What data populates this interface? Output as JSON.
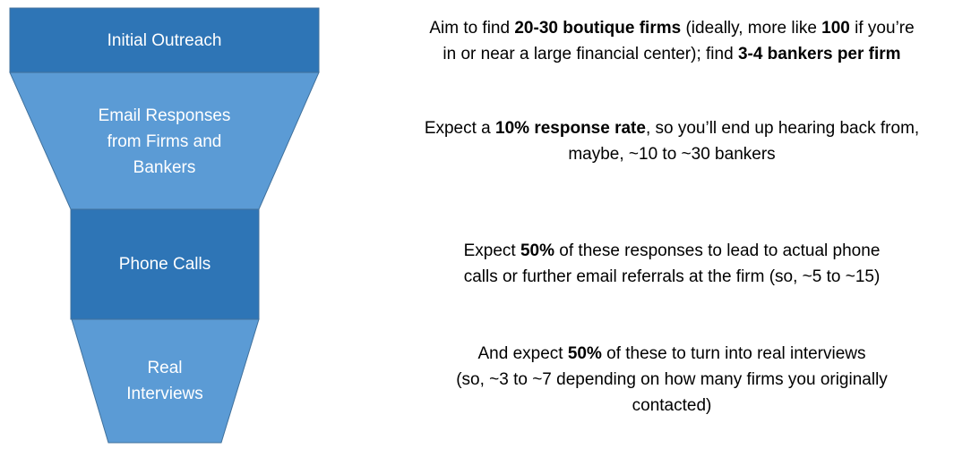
{
  "colors": {
    "dark_stage": "#2E75B6",
    "light_stage": "#5B9BD5",
    "outline": "#41719C"
  },
  "stages": [
    {
      "label": "Initial Outreach"
    },
    {
      "label": "Email Responses from Firms and Bankers"
    },
    {
      "label": "Phone Calls"
    },
    {
      "label": "Real Interviews"
    }
  ],
  "descriptions": [
    {
      "lines": [
        [
          {
            "t": "Aim to find "
          },
          {
            "t": "20-30 boutique firms",
            "b": true
          },
          {
            "t": " (ideally, more like "
          },
          {
            "t": "100",
            "b": true
          },
          {
            "t": " if you’re"
          }
        ],
        [
          {
            "t": "in or near a large financial center); find "
          },
          {
            "t": "3-4 bankers per firm",
            "b": true
          }
        ]
      ]
    },
    {
      "lines": [
        [
          {
            "t": "Expect a "
          },
          {
            "t": "10% response rate",
            "b": true
          },
          {
            "t": ", so you’ll end up hearing back from,"
          }
        ],
        [
          {
            "t": "maybe, ~10 to ~30 bankers"
          }
        ]
      ]
    },
    {
      "lines": [
        [
          {
            "t": "Expect "
          },
          {
            "t": "50%",
            "b": true
          },
          {
            "t": " of these responses to lead to actual phone"
          }
        ],
        [
          {
            "t": "calls or further email referrals at the firm (so, ~5 to ~15)"
          }
        ]
      ]
    },
    {
      "lines": [
        [
          {
            "t": "And expect "
          },
          {
            "t": "50%",
            "b": true
          },
          {
            "t": " of these to turn into real interviews"
          }
        ],
        [
          {
            "t": "(so, ~3 to ~7 depending on how many firms you originally"
          }
        ],
        [
          {
            "t": "contacted)"
          }
        ]
      ]
    }
  ]
}
